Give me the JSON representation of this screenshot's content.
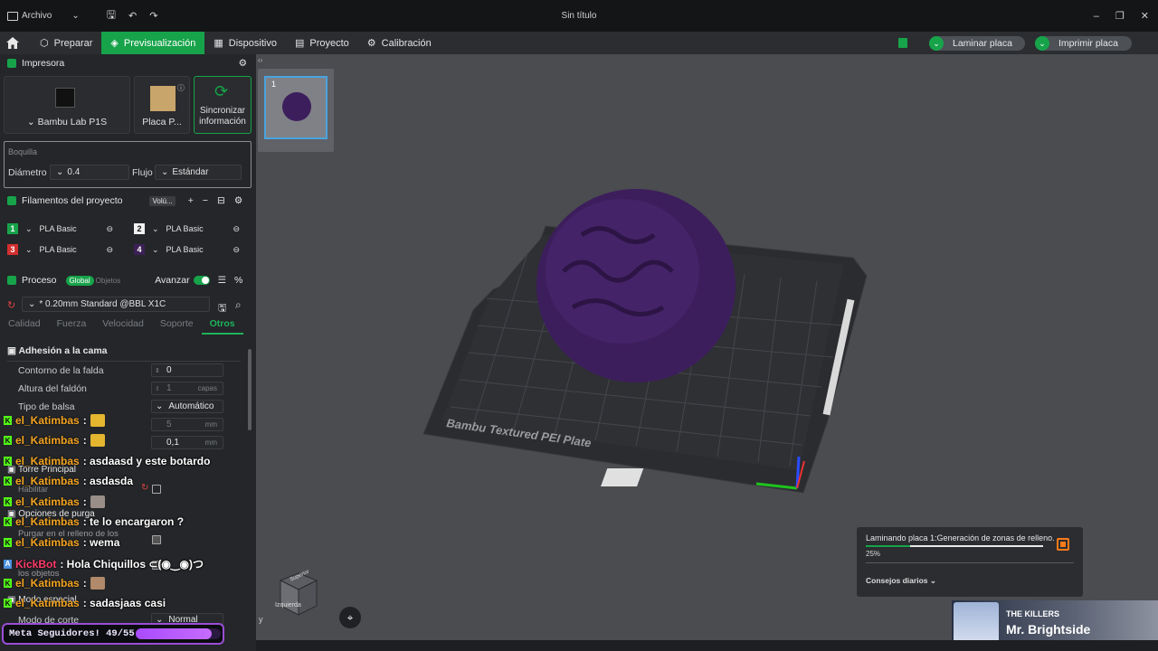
{
  "titlebar": {
    "menu_label": "Archivo",
    "window_title": "Sin título"
  },
  "tabs": [
    {
      "label": "Preparar"
    },
    {
      "label": "Previsualización",
      "active": true
    },
    {
      "label": "Dispositivo"
    },
    {
      "label": "Proyecto"
    },
    {
      "label": "Calibración"
    }
  ],
  "actions": {
    "slice": "Laminar placa",
    "print": "Imprimir placa"
  },
  "printer": {
    "section": "Impresora",
    "name": "Bambu Lab P1S",
    "plate": "Placa P...",
    "sync": "Sincronizar información"
  },
  "nozzle": {
    "title": "Boquilla",
    "diameter_label": "Diámetro",
    "diameter": "0.4",
    "flow_label": "Flujo",
    "flow": "Estándar"
  },
  "filaments": {
    "section": "Filamentos del proyecto",
    "volume_btn": "Volú...",
    "items": [
      {
        "num": "1",
        "color": "#17a34a",
        "name": "PLA Basic"
      },
      {
        "num": "2",
        "color": "#ffffff",
        "name": "PLA Basic"
      },
      {
        "num": "3",
        "color": "#d32f2f",
        "name": "PLA Basic"
      },
      {
        "num": "4",
        "color": "#5b2a86",
        "name": "PLA Basic"
      }
    ]
  },
  "process": {
    "section": "Proceso",
    "global": "Global",
    "objects": "Objetos",
    "advanced": "Avanzar",
    "preset": "* 0.20mm Standard @BBL X1C",
    "subtabs": [
      "Calidad",
      "Fuerza",
      "Velocidad",
      "Soporte",
      "Otros"
    ],
    "bed_adhesion": "Adhesión a la cama",
    "skirt_loops_label": "Contorno de la falda",
    "skirt_loops": "0",
    "skirt_height_label": "Altura del faldón",
    "skirt_height": "1",
    "skirt_height_unit": "capas",
    "raft_type_label": "Tipo de balsa",
    "raft_type": "Automático",
    "row_a_value": "5",
    "row_a_unit": "mm",
    "row_b_value": "0,1",
    "row_b_unit": "mm",
    "prime_tower": "Torre Principal",
    "enable": "Habilitar",
    "purge_options": "Opciones de purga",
    "purge_infill": "Purgar en el relleno de los",
    "objects_label": "los objetos",
    "special_mode": "Modo especial",
    "slice_mode_label": "Modo de corte",
    "slice_mode": "Normal"
  },
  "chat": [
    {
      "user": "el_Katimbas",
      "text": ":"
    },
    {
      "user": "el_Katimbas",
      "text": ":"
    },
    {
      "user": "el_Katimbas",
      "text": ": asdaasd y este botardo"
    },
    {
      "user": "el_Katimbas",
      "text": ": asdasda"
    },
    {
      "user": "el_Katimbas",
      "text": ":"
    },
    {
      "user": "el_Katimbas",
      "text": ": te lo encargaron ?"
    },
    {
      "user": "el_Katimbas",
      "text": ": wema"
    },
    {
      "user": "KickBot",
      "text": ": Hola Chiquillos ⊂(◉‿◉)つ"
    },
    {
      "user": "el_Katimbas",
      "text": ":"
    },
    {
      "user": "el_Katimbas",
      "text": ": sadasjaas casi"
    }
  ],
  "goal": {
    "label": "Meta Seguidores! 49/55",
    "progress": 0.89
  },
  "plate_thumb": {
    "number": "1"
  },
  "bed_label": "Bambu Textured PEI Plate",
  "slicing": {
    "status": "Laminando placa 1:Generación de zonas de relleno.",
    "percent": "25%",
    "progress": 0.25,
    "tips": "Consejos diarios"
  },
  "viewcube": {
    "top": "Superior",
    "left": "Izquierda",
    "axis": "y"
  },
  "music": {
    "artist": "THE KILLERS",
    "title": "Mr. Brightside"
  },
  "colors": {
    "accent": "#17a34a",
    "object": "#3d1e5c",
    "goal": "#a94bff"
  }
}
